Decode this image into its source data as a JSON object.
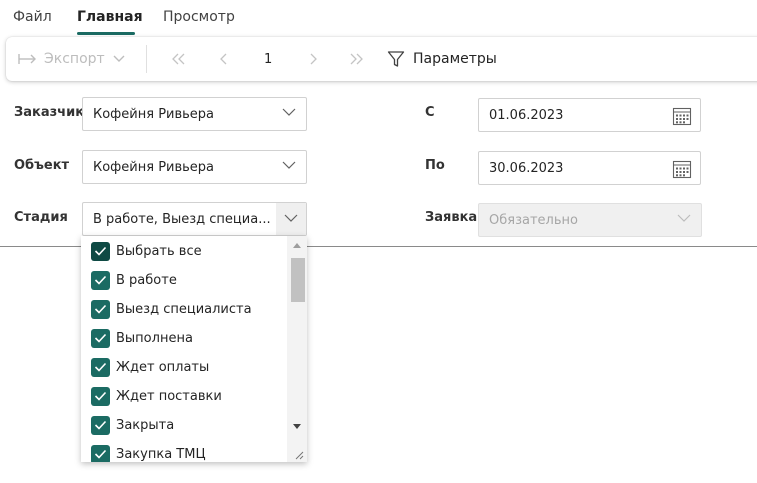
{
  "tabs": [
    {
      "label": "Файл",
      "active": false
    },
    {
      "label": "Главная",
      "active": true
    },
    {
      "label": "Просмотр",
      "active": false
    }
  ],
  "toolbar": {
    "export_label": "Экспорт",
    "page_number": "1",
    "params_label": "Параметры"
  },
  "filters": {
    "customer": {
      "label": "Заказчик",
      "value": "Кофейня Ривьера"
    },
    "object": {
      "label": "Объект",
      "value": "Кофейня Ривьера"
    },
    "stage": {
      "label": "Стадия",
      "value": "В работе, Выезд специа..."
    },
    "date_from": {
      "label": "С",
      "value": "01.06.2023"
    },
    "date_to": {
      "label": "По",
      "value": "30.06.2023"
    },
    "request": {
      "label": "Заявка",
      "value": "Обязательно"
    }
  },
  "stage_dropdown": {
    "items": [
      {
        "label": "Выбрать все",
        "checked": true
      },
      {
        "label": "В работе",
        "checked": true
      },
      {
        "label": "Выезд специалиста",
        "checked": true
      },
      {
        "label": "Выполнена",
        "checked": true
      },
      {
        "label": "Ждет оплаты",
        "checked": true
      },
      {
        "label": "Ждет поставки",
        "checked": true
      },
      {
        "label": "Закрыта",
        "checked": true
      },
      {
        "label": "Закупка ТМЦ",
        "checked": true
      }
    ]
  },
  "colors": {
    "accent": "#1b6b63",
    "checkbox_dark": "#0f4a44"
  }
}
